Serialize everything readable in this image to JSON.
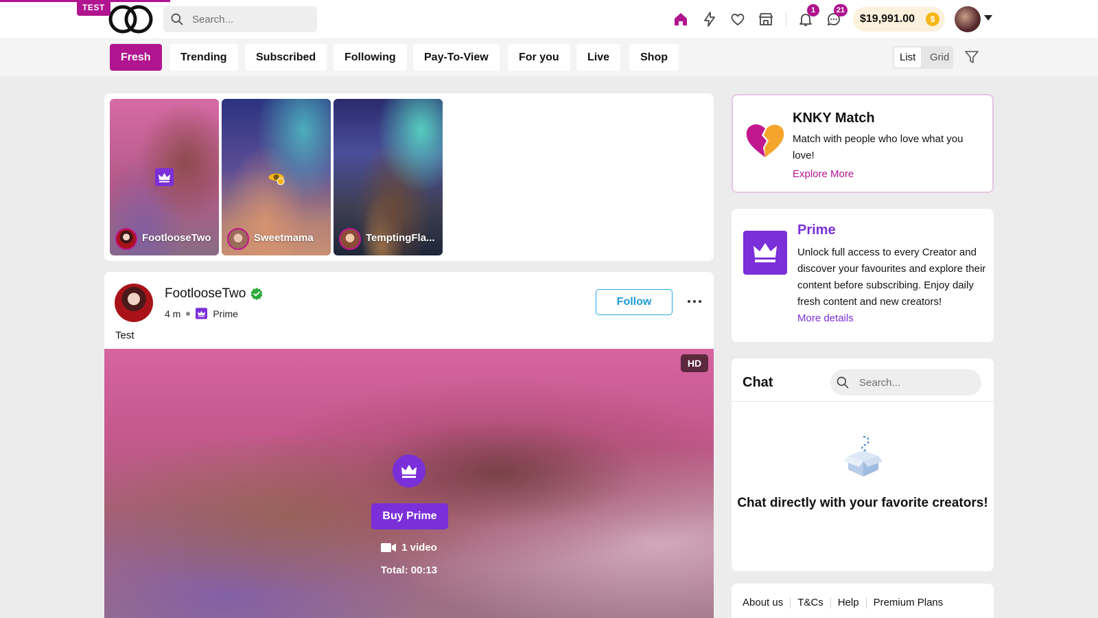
{
  "header": {
    "env_badge": "TEST",
    "search_placeholder": "Search...",
    "icons": [
      "home-icon",
      "lightning-icon",
      "heart-icon",
      "shop-icon",
      "bell-icon",
      "chat-icon"
    ],
    "notifications_count": "1",
    "messages_count": "21",
    "wallet_balance": "$19,991.00",
    "coin_symbol": "$",
    "colors": {
      "brand": "#b0148f",
      "prime": "#7b2fd9",
      "follow": "#26a6e0",
      "coin": "#f6b716"
    }
  },
  "filters": {
    "tabs": [
      {
        "label": "Fresh",
        "active": true
      },
      {
        "label": "Trending",
        "active": false
      },
      {
        "label": "Subscribed",
        "active": false
      },
      {
        "label": "Following",
        "active": false
      },
      {
        "label": "Pay-To-View",
        "active": false
      },
      {
        "label": "For you",
        "active": false
      },
      {
        "label": "Live",
        "active": false
      },
      {
        "label": "Shop",
        "active": false
      }
    ],
    "view_list": "List",
    "view_grid": "Grid",
    "selected_view": "List"
  },
  "stories": [
    {
      "name": "FootlooseTwo",
      "icon": "crown-icon"
    },
    {
      "name": "Sweetmama",
      "icon": "pay-to-view-icon"
    },
    {
      "name": "TemptingFla...",
      "icon": ""
    }
  ],
  "post": {
    "author": "FootlooseTwo",
    "verified": true,
    "time": "4 m",
    "tier": "Prime",
    "follow_label": "Follow",
    "text": "Test",
    "quality_badge": "HD",
    "buy_label": "Buy Prime",
    "video_count": "1 video",
    "total_duration": "Total: 00:13"
  },
  "match_card": {
    "title": "KNKY Match",
    "description": "Match with people who love what you love!",
    "link": "Explore More"
  },
  "prime_card": {
    "title": "Prime",
    "description": "Unlock full access to every Creator and discover your favourites and explore their content before subscribing. Enjoy daily fresh content and new creators!",
    "link": "More details"
  },
  "chat_card": {
    "title": "Chat",
    "search_placeholder": "Search...",
    "empty_message": "Chat directly with your favorite creators!"
  },
  "footer": {
    "links": [
      "About us",
      "T&Cs",
      "Help",
      "Premium Plans"
    ]
  }
}
